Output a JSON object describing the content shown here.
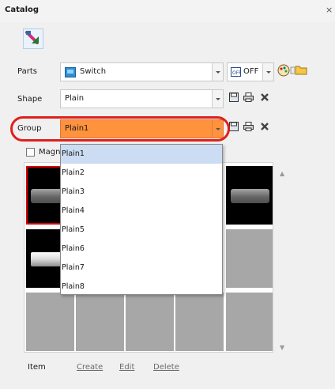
{
  "window": {
    "title": "Catalog",
    "close_glyph": "×"
  },
  "toolbar": {
    "primary_icon": "arrow-shape-tool-icon"
  },
  "parts": {
    "label": "Parts",
    "value": "Switch",
    "value_icon": "switch-icon",
    "state_value": "OFF",
    "state_icon": "off-switch-icon",
    "actions": [
      "color-palette-icon",
      "folder-icon"
    ]
  },
  "shape": {
    "label": "Shape",
    "value": "Plain",
    "actions": [
      "save-icon",
      "print-icon",
      "delete-icon"
    ]
  },
  "group": {
    "label": "Group",
    "value": "Plain1",
    "actions": [
      "save-icon",
      "print-icon",
      "delete-icon"
    ],
    "options": [
      "Plain1",
      "Plain2",
      "Plain3",
      "Plain4",
      "Plain5",
      "Plain6",
      "Plain7",
      "Plain8"
    ],
    "selected_index": 0
  },
  "magnify": {
    "label": "Magni"
  },
  "colors": {
    "group_bg": "#ff923d",
    "highlight": "#e0201c",
    "dropdown_selected": "#cbdcf3"
  },
  "footer": {
    "item_label": "Item",
    "create_label": "Create",
    "edit_label": "Edit",
    "delete_label": "Delete"
  }
}
